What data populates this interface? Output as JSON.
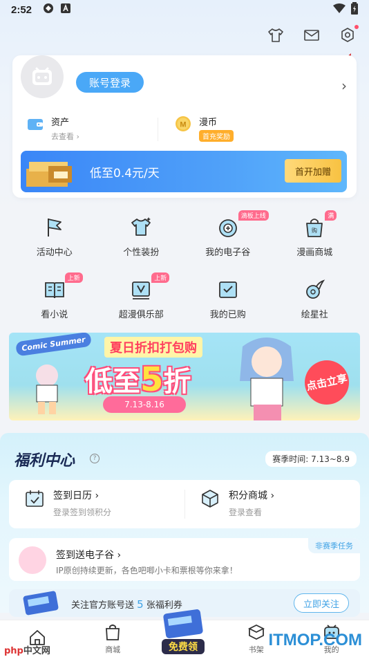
{
  "status_bar": {
    "time": "2:52"
  },
  "profile": {
    "login_label": "账号登录",
    "assets": {
      "title": "资产",
      "subtitle": "去查看"
    },
    "comic_coin": {
      "title": "漫币",
      "badge": "首充奖励",
      "coin_letter": "M"
    }
  },
  "vip_banner": {
    "text": "低至0.4元/天",
    "button": "首开加赠"
  },
  "grid": [
    {
      "label": "活动中心",
      "icon": "flag-icon",
      "badge": ""
    },
    {
      "label": "个性装扮",
      "icon": "tshirt-icon",
      "badge": ""
    },
    {
      "label": "我的电子谷",
      "icon": "gu-icon",
      "badge": "滴板上线"
    },
    {
      "label": "漫画商城",
      "icon": "shopping-bag-icon",
      "badge": "满"
    },
    {
      "label": "看小说",
      "icon": "book-icon",
      "badge": "上新"
    },
    {
      "label": "超漫俱乐部",
      "icon": "vip-club-icon",
      "badge": "上新"
    },
    {
      "label": "我的已购",
      "icon": "purchased-icon",
      "badge": ""
    },
    {
      "label": "绘星社",
      "icon": "comet-icon",
      "badge": ""
    }
  ],
  "promo_banner": {
    "logo": "Comic Summer",
    "title": "夏日折扣打包购",
    "big_text": "低至",
    "big_number": "5",
    "big_suffix": "折",
    "date": "7.13-8.16",
    "cta": "点击立享"
  },
  "welfare": {
    "title": "福利中心",
    "help": "?",
    "season": "赛季时间: 7.13~8.9",
    "checkin": {
      "title": "签到日历",
      "subtitle": "登录签到领积分"
    },
    "points_mall": {
      "title": "积分商城",
      "subtitle": "登录查看"
    },
    "task": {
      "tag": "非赛季任务",
      "title": "签到送电子谷",
      "subtitle": "IP原创持续更新，各色吧唧小卡和票根等你来拿！"
    },
    "follow": {
      "text_before": "关注官方账号送",
      "number": "5",
      "text_after": "张福利券",
      "button": "立即关注"
    }
  },
  "tabbar": {
    "items": [
      {
        "label": "",
        "icon": "home-icon"
      },
      {
        "label": "商城",
        "icon": "mall-icon"
      },
      {
        "label": "书架",
        "icon": "bookshelf-icon"
      },
      {
        "label": "我的",
        "icon": "profile-icon"
      }
    ],
    "center_label": "免费领"
  },
  "watermarks": {
    "left_a": "php",
    "left_b": "中文网",
    "right": "ITMOP.COM"
  }
}
